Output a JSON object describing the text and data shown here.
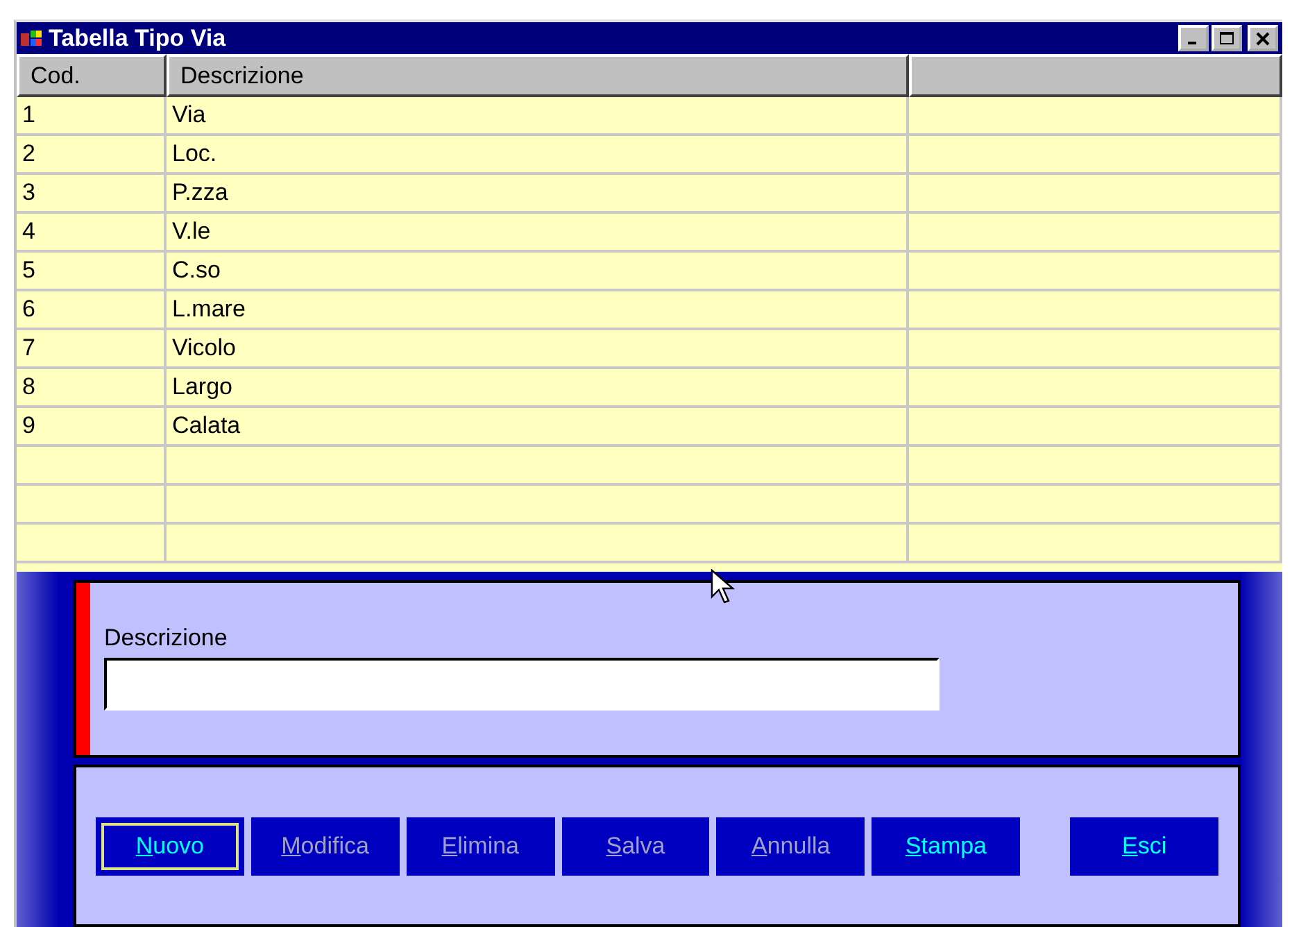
{
  "window": {
    "title": "Tabella Tipo Via"
  },
  "table": {
    "columns": [
      "Cod.",
      "Descrizione"
    ],
    "rows": [
      {
        "code": "1",
        "description": "Via"
      },
      {
        "code": "2",
        "description": "Loc."
      },
      {
        "code": "3",
        "description": "P.zza"
      },
      {
        "code": "4",
        "description": "V.le"
      },
      {
        "code": "5",
        "description": "C.so"
      },
      {
        "code": "6",
        "description": "L.mare"
      },
      {
        "code": "7",
        "description": "Vicolo"
      },
      {
        "code": "8",
        "description": "Largo"
      },
      {
        "code": "9",
        "description": "Calata"
      }
    ]
  },
  "form": {
    "label": "Descrizione"
  },
  "buttons": [
    {
      "label": "Nuovo",
      "disabled": false,
      "focused": true
    },
    {
      "label": "Modifica",
      "disabled": true,
      "focused": false
    },
    {
      "label": "Elimina",
      "disabled": true,
      "focused": false
    },
    {
      "label": "Salva",
      "disabled": true,
      "focused": false
    },
    {
      "label": "Annulla",
      "disabled": true,
      "focused": false
    },
    {
      "label": "Stampa",
      "disabled": false,
      "focused": false
    },
    {
      "label": "Esci",
      "disabled": false,
      "focused": false
    }
  ]
}
